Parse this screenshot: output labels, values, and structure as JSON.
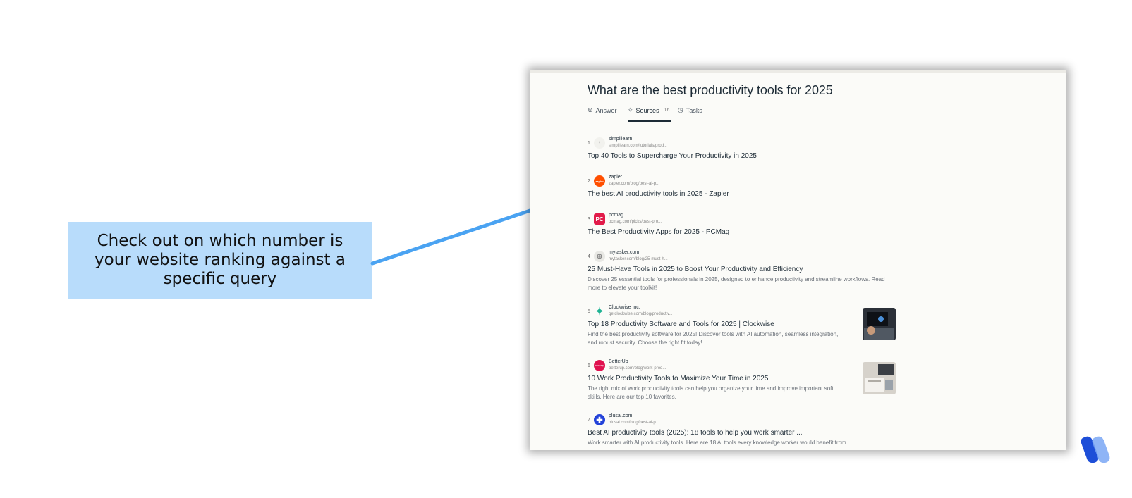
{
  "callout": {
    "text": "Check out on which number is your website ranking against a specific query"
  },
  "query_title": "What are the best productivity tools for 2025",
  "tabs": [
    {
      "label": "Answer",
      "icon": "answer-icon"
    },
    {
      "label": "Sources",
      "icon": "sources-icon",
      "count": "16"
    },
    {
      "label": "Tasks",
      "icon": "tasks-icon"
    }
  ],
  "results": [
    {
      "number": "1",
      "site": "simplilearn",
      "url": "simplilearn.com/tutorials/prod...",
      "title": "Top 40 Tools to Supercharge Your Productivity in 2025",
      "logo_icon": "simplilearn-logo-icon",
      "logo_color": "#f2f2ee",
      "logo_text": ""
    },
    {
      "number": "2",
      "site": "zapier",
      "url": "zapier.com/blog/best-ai-p...",
      "title": "The best AI productivity tools in 2025 - Zapier",
      "logo_icon": "zapier-logo-icon",
      "logo_color": "#ff4f00",
      "logo_text": "zapier"
    },
    {
      "number": "3",
      "site": "pcmag",
      "url": "pcmag.com/picks/best-pro...",
      "title": "The Best Productivity Apps for 2025 - PCMag",
      "logo_icon": "pcmag-logo-icon",
      "logo_color": "#e21b4a",
      "logo_text": "PC"
    },
    {
      "number": "4",
      "site": "mytasker.com",
      "url": "mytasker.com/blog/25-must-h...",
      "title": "25 Must-Have Tools in 2025 to Boost Your Productivity and Efficiency",
      "description": "Discover 25 essential tools for professionals in 2025, designed to enhance productivity and streamline workflows. Read more to elevate your toolkit!",
      "logo_icon": "globe-icon",
      "logo_color": "#e8e8e4",
      "logo_text": ""
    },
    {
      "number": "5",
      "site": "Clockwise Inc.",
      "url": "getclockwise.com/blog/productiv...",
      "title": "Top 18 Productivity Software and Tools for 2025 | Clockwise",
      "description": "Find the best productivity software for 2025! Discover tools with AI automation, seamless integration, and robust security. Choose the right fit today!",
      "logo_icon": "clockwise-logo-icon",
      "logo_color": "#1fb394",
      "logo_text": "",
      "thumb": "laptop-photo-icon"
    },
    {
      "number": "6",
      "site": "BetterUp",
      "url": "betterup.com/blog/work-prod...",
      "title": "10 Work Productivity Tools to Maximize Your Time in 2025",
      "description": "The right mix of work productivity tools can help you organize your time and improve important soft skills. Here are our top 10 favorites.",
      "logo_icon": "betterup-logo-icon",
      "logo_color": "#e0114f",
      "logo_text": "BetterUp",
      "thumb": "desk-photo-icon"
    },
    {
      "number": "7",
      "site": "plusai.com",
      "url": "plusai.com/blog/best-ai-p...",
      "title": "Best AI productivity tools (2025): 18 tools to help you work smarter ...",
      "description": "Work smarter with AI productivity tools. Here are 18 AI tools every knowledge worker would benefit from.",
      "logo_icon": "plusai-logo-icon",
      "logo_color": "#2342d9",
      "logo_text": ""
    }
  ],
  "colors": {
    "callout_bg": "#b8dcfb",
    "arrow": "#4aa3f2",
    "brand_logo": "#1d4ed8"
  }
}
